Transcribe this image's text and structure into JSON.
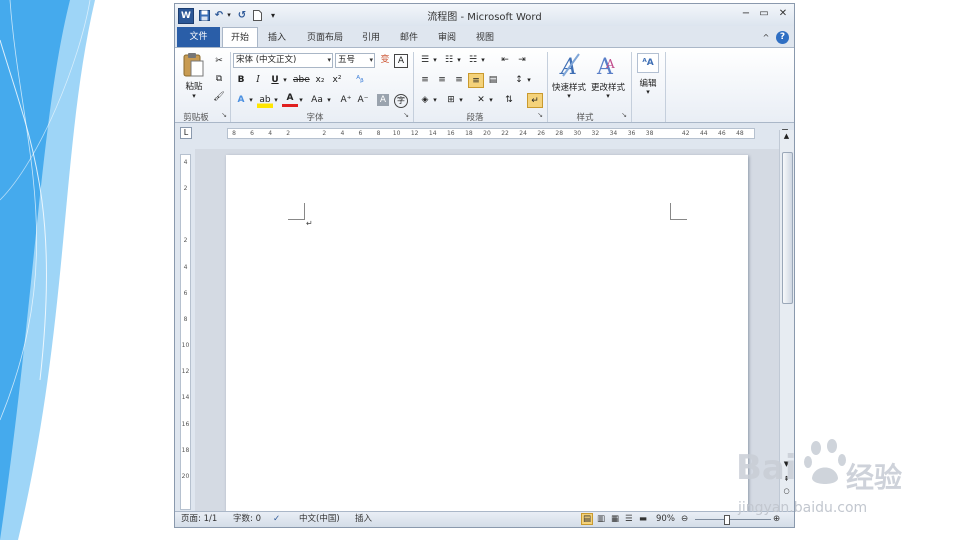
{
  "window": {
    "title": "流程图 - Microsoft Word",
    "app_icon": "W",
    "buttons": {
      "minimize": "−",
      "restore": "▭",
      "close": "✕"
    }
  },
  "quick_access": {
    "save": "save-icon",
    "undo": "↶",
    "redo": "↺",
    "new": "new-doc-icon",
    "customize": "▾"
  },
  "tabs": [
    {
      "label": "文件",
      "active": false,
      "file": true
    },
    {
      "label": "开始",
      "active": true
    },
    {
      "label": "插入"
    },
    {
      "label": "页面布局"
    },
    {
      "label": "引用"
    },
    {
      "label": "邮件"
    },
    {
      "label": "审阅"
    },
    {
      "label": "视图"
    }
  ],
  "ribbon": {
    "clipboard": {
      "label": "剪贴板",
      "paste": "粘贴"
    },
    "font": {
      "label": "字体",
      "font_name": "宋体 (中文正文)",
      "font_size": "五号",
      "bold": "B",
      "italic": "I",
      "underline": "U",
      "strike": "abe",
      "subscript": "x₂",
      "superscript": "x²",
      "text_effect": "A",
      "font_color": "A",
      "change_case": "Aa",
      "grow": "A⁺",
      "shrink": "A⁻",
      "char_shading": "A",
      "enclose": "字"
    },
    "paragraph": {
      "label": "段落"
    },
    "styles": {
      "label": "样式",
      "quick_styles": "快速样式",
      "change_styles": "更改样式"
    },
    "editing": {
      "label": "编辑"
    }
  },
  "ruler": {
    "h_ticks": [
      "8",
      "6",
      "4",
      "2",
      "",
      "2",
      "4",
      "6",
      "8",
      "10",
      "12",
      "14",
      "16",
      "18",
      "20",
      "22",
      "24",
      "26",
      "28",
      "30",
      "32",
      "34",
      "36",
      "38",
      "",
      "42",
      "44",
      "46",
      "48"
    ],
    "v_ticks": [
      "4",
      "2",
      "",
      "2",
      "4",
      "6",
      "8",
      "10",
      "12",
      "14",
      "16",
      "18",
      "20"
    ]
  },
  "document": {
    "paragraph_mark": "↵"
  },
  "status": {
    "page": "页面: 1/1",
    "words": "字数: 0",
    "language": "中文(中国)",
    "mode": "插入",
    "zoom": "90%"
  },
  "watermark": {
    "brand": "Bai",
    "brand2": "经验",
    "url": "jingyan.baidu.com"
  }
}
